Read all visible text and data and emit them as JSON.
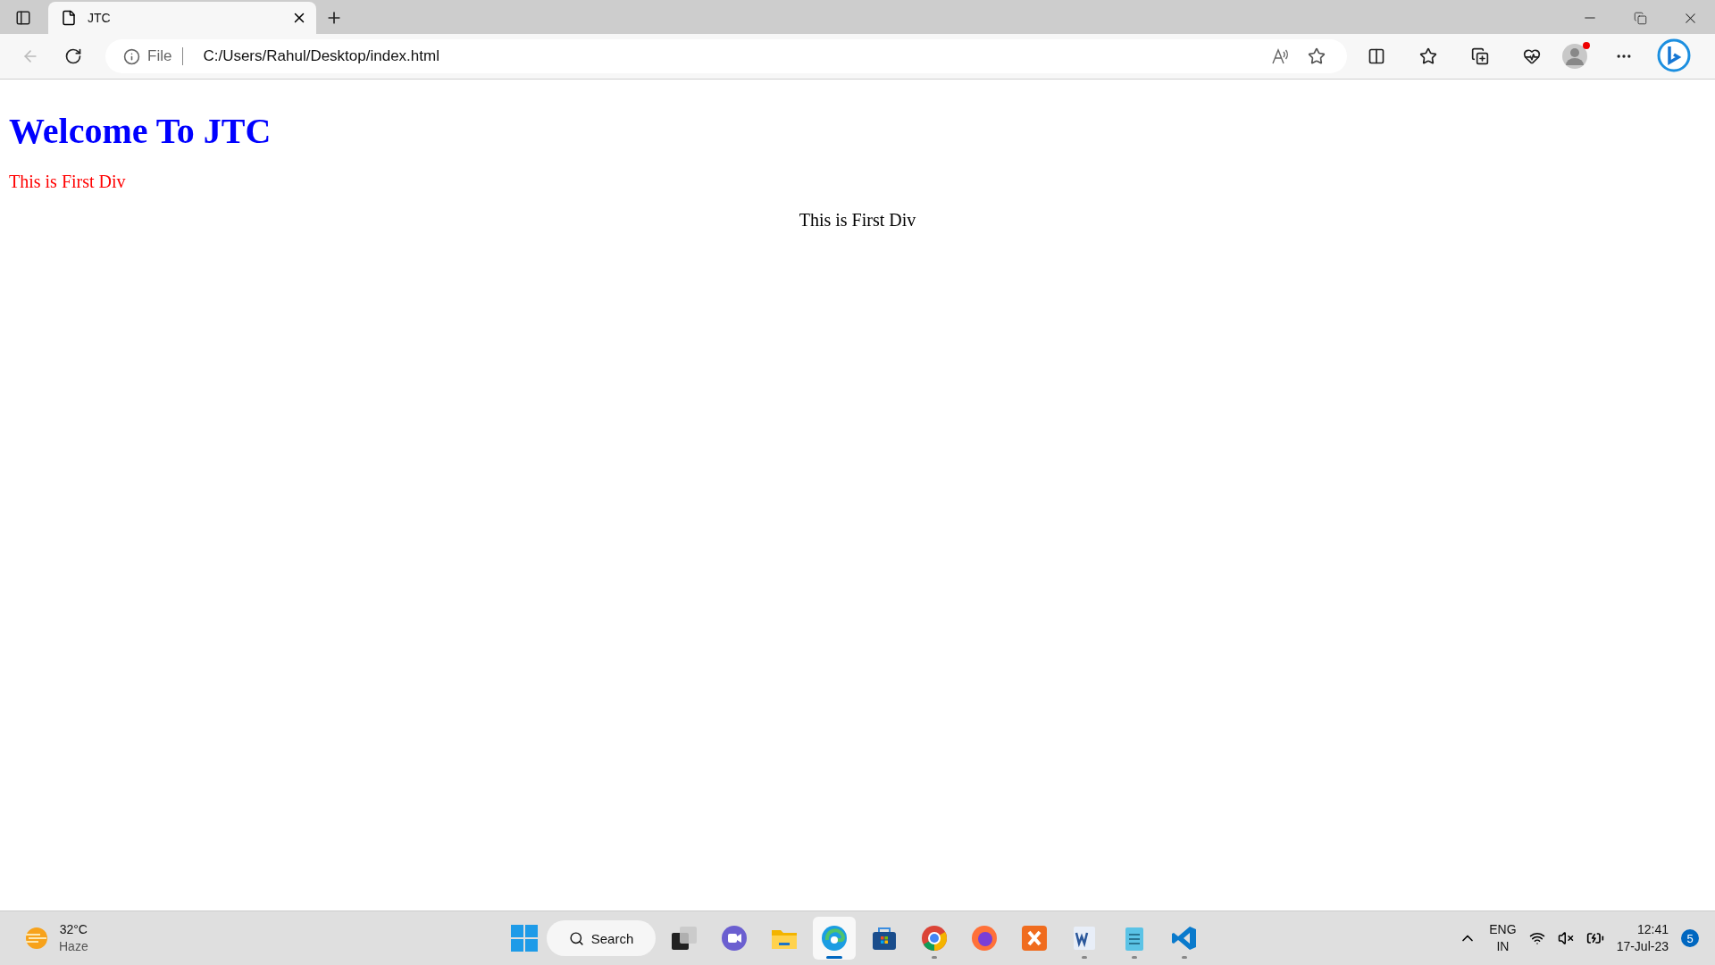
{
  "browser": {
    "tabs": [
      {
        "title": "JTC",
        "selected": true
      }
    ],
    "address": {
      "scheme": "File",
      "url": "C:/Users/Rahul/Desktop/index.html"
    }
  },
  "page": {
    "heading": "Welcome To JTC",
    "divs": [
      {
        "text": "This is First Div",
        "kind": "left",
        "color": "#ff0000"
      },
      {
        "text": "This is First Div",
        "kind": "center",
        "color": "#000000"
      }
    ]
  },
  "taskbar": {
    "weather": {
      "temperature": "32°C",
      "condition": "Haze"
    },
    "search": "Search",
    "apps": [
      {
        "kind": "taskview",
        "running": false,
        "selected": false
      },
      {
        "kind": "chat",
        "running": false,
        "selected": false
      },
      {
        "kind": "folder",
        "running": false,
        "selected": false
      },
      {
        "kind": "edge",
        "running": true,
        "selected": true
      },
      {
        "kind": "store",
        "running": false,
        "selected": false
      },
      {
        "kind": "chrome",
        "running": true,
        "selected": false
      },
      {
        "kind": "firefox",
        "running": false,
        "selected": false
      },
      {
        "kind": "xampp",
        "running": false,
        "selected": false
      },
      {
        "kind": "word",
        "running": true,
        "selected": false
      },
      {
        "kind": "notepad",
        "running": true,
        "selected": false
      },
      {
        "kind": "vscode",
        "running": true,
        "selected": false
      }
    ],
    "tray": {
      "language": "ENG",
      "region": "IN",
      "time": "12:41",
      "date": "17-Jul-23",
      "notifications": "5"
    }
  }
}
